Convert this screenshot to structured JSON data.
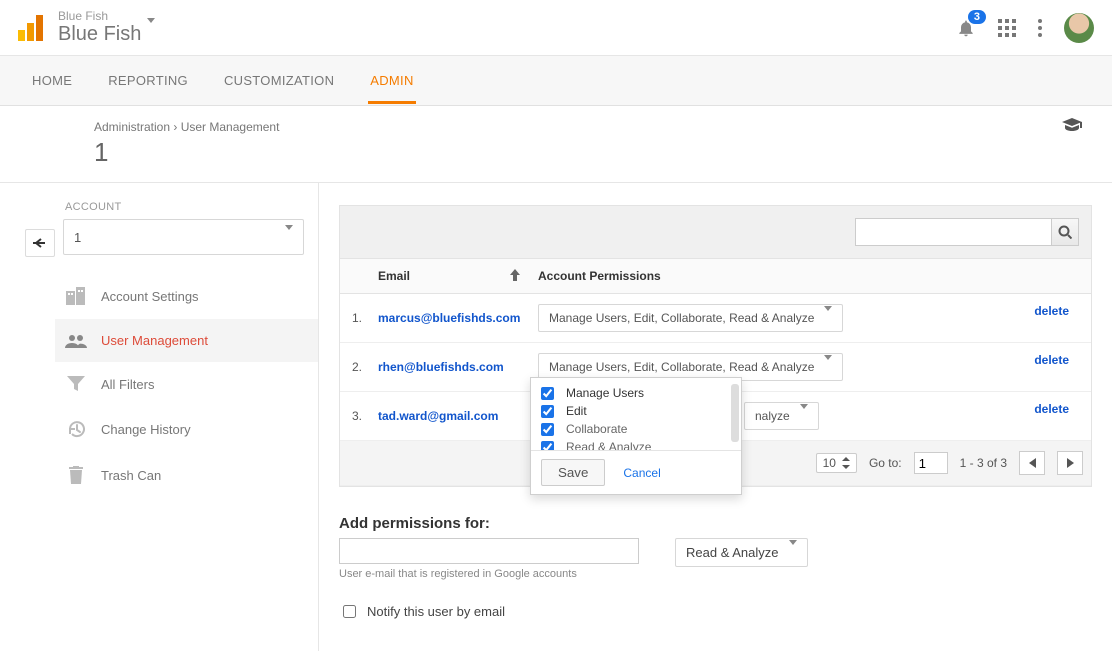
{
  "header": {
    "brand_small": "Blue Fish",
    "brand_main": "Blue Fish",
    "notification_count": "3"
  },
  "nav": {
    "home": "HOME",
    "reporting": "REPORTING",
    "customization": "CUSTOMIZATION",
    "admin": "ADMIN"
  },
  "breadcrumb": {
    "root": "Administration",
    "sep": "›",
    "current": "User Management",
    "page_number": "1"
  },
  "sidebar": {
    "section_label": "ACCOUNT",
    "account_selected": "1",
    "items": {
      "settings": "Account Settings",
      "user_mgmt": "User Management",
      "filters": "All Filters",
      "history": "Change History",
      "trash": "Trash Can"
    }
  },
  "table": {
    "col_email": "Email",
    "col_perm": "Account Permissions",
    "rows": {
      "r1": {
        "idx": "1.",
        "email": "marcus@bluefishds.com",
        "perm": "Manage Users, Edit, Collaborate, Read & Analyze",
        "del": "delete"
      },
      "r2": {
        "idx": "2.",
        "email": "rhen@bluefishds.com",
        "perm": "Manage Users, Edit, Collaborate, Read & Analyze",
        "del": "delete"
      },
      "r3": {
        "idx": "3.",
        "email": "tad.ward@gmail.com",
        "perm": "nalyze",
        "del": "delete"
      }
    },
    "popover": {
      "opt1": "Manage Users",
      "opt2": "Edit",
      "opt3": "Collaborate",
      "opt4": "Read & Analyze",
      "save": "Save",
      "cancel": "Cancel"
    },
    "footer": {
      "rows_value": "10",
      "goto_label": "Go to:",
      "goto_value": "1",
      "range": "1 - 3 of 3"
    }
  },
  "add": {
    "title": "Add permissions for:",
    "hint": "User e-mail that is registered in Google accounts",
    "perm_default": "Read & Analyze",
    "notify": "Notify this user by email"
  }
}
